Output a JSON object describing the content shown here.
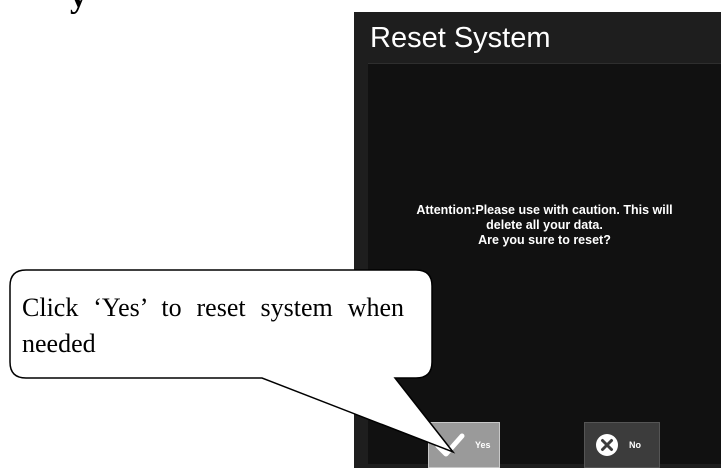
{
  "page": {
    "heading": "y"
  },
  "dialog": {
    "title": "Reset System",
    "message_lines": [
      "Attention:Please use with caution. This will",
      "delete all your data.",
      "Are you sure to reset?"
    ],
    "buttons": {
      "yes_label": "Yes",
      "yes_icon": "check-icon",
      "no_label": "No",
      "no_icon": "close-circle-icon"
    }
  },
  "callout": {
    "text": "Click ‘Yes’ to reset system when needed"
  },
  "colors": {
    "dialog_background": "#1e1e1e",
    "body_background": "#111111",
    "yes_button": "#9a9a9a",
    "no_button": "#3c3c3c",
    "text": "#ffffff"
  }
}
